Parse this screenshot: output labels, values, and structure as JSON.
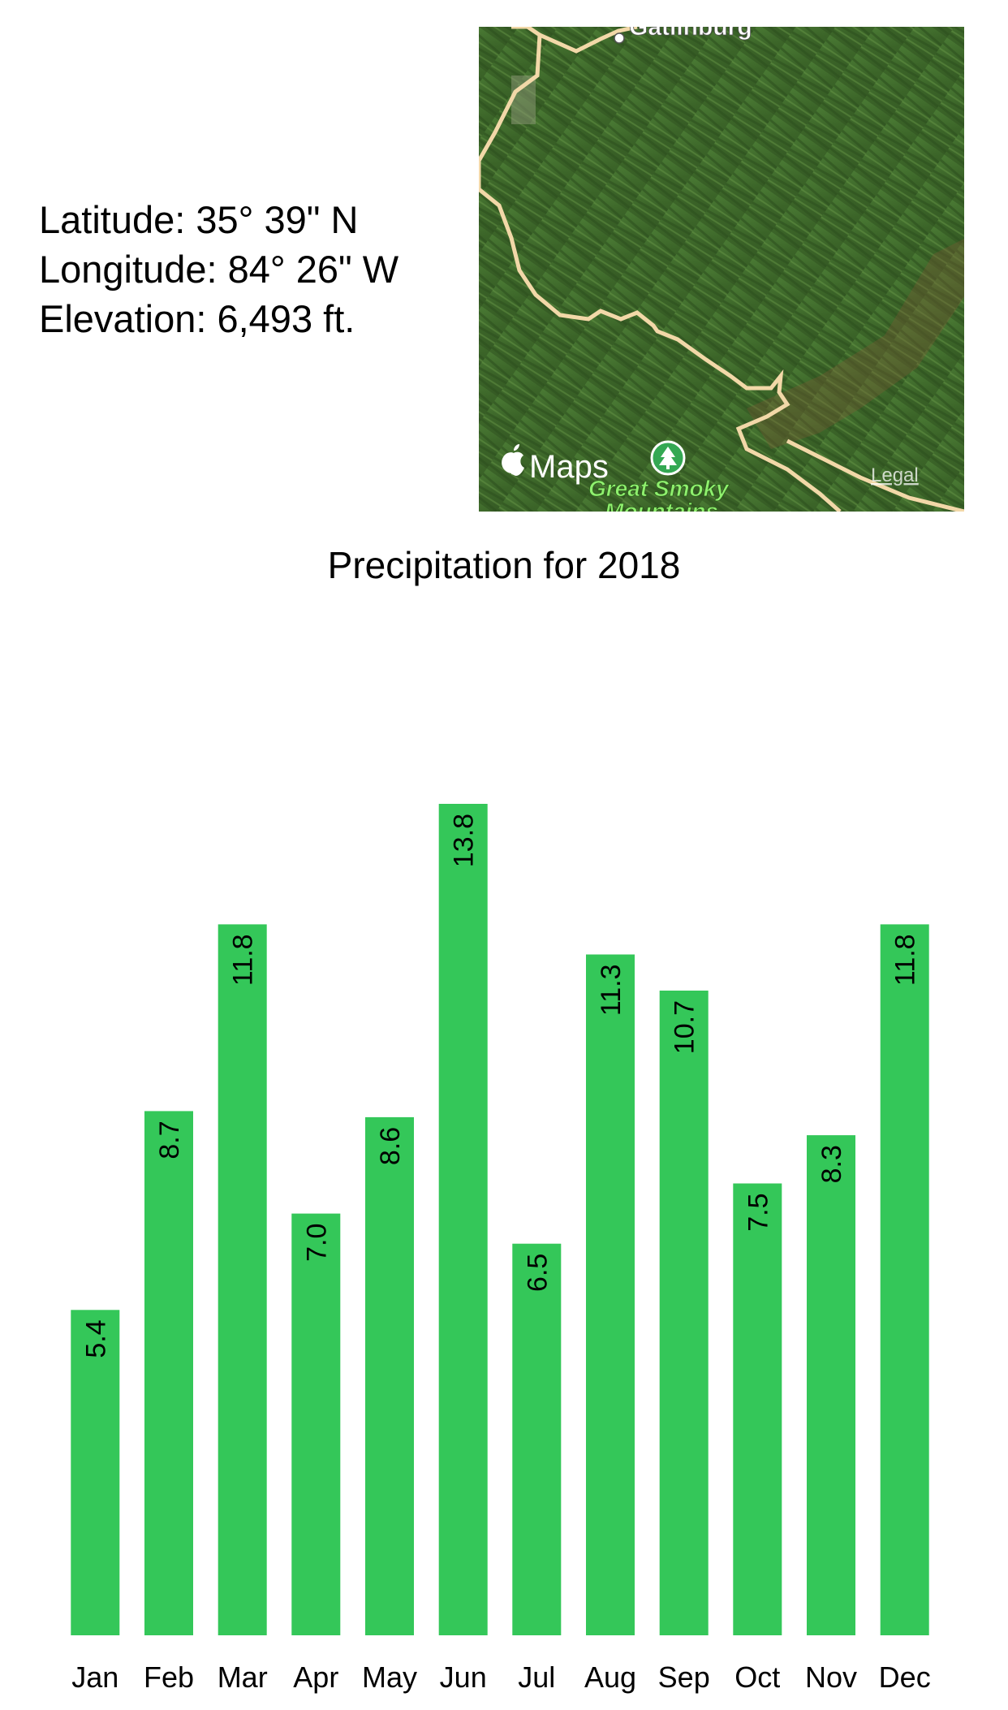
{
  "location": {
    "latitude": "Latitude: 35° 39\" N",
    "longitude": "Longitude: 84° 26\" W",
    "elevation": "Elevation: 6,493 ft."
  },
  "map": {
    "city_label": "Gatlinburg",
    "park_label_line1": "Great Smoky",
    "park_label_line2": "Mountains",
    "maps_brand": "Maps",
    "legal_link": "Legal",
    "icons": [
      "apple-logo-icon",
      "tree-icon",
      "city-dot-icon"
    ]
  },
  "chart_data": {
    "type": "bar",
    "title": "Precipitation for 2018",
    "categories": [
      "Jan",
      "Feb",
      "Mar",
      "Apr",
      "May",
      "Jun",
      "Jul",
      "Aug",
      "Sep",
      "Oct",
      "Nov",
      "Dec"
    ],
    "values": [
      5.4,
      8.7,
      11.8,
      7.0,
      8.6,
      13.8,
      6.5,
      11.3,
      10.7,
      7.5,
      8.3,
      11.8
    ],
    "value_labels": [
      "5.4",
      "8.7",
      "11.8",
      "7.0",
      "8.6",
      "13.8",
      "6.5",
      "11.3",
      "10.7",
      "7.5",
      "8.3",
      "11.8"
    ],
    "ylim": [
      0,
      13.8
    ],
    "bar_color": "#34c759",
    "grid": false,
    "xlabel": "",
    "ylabel": ""
  }
}
